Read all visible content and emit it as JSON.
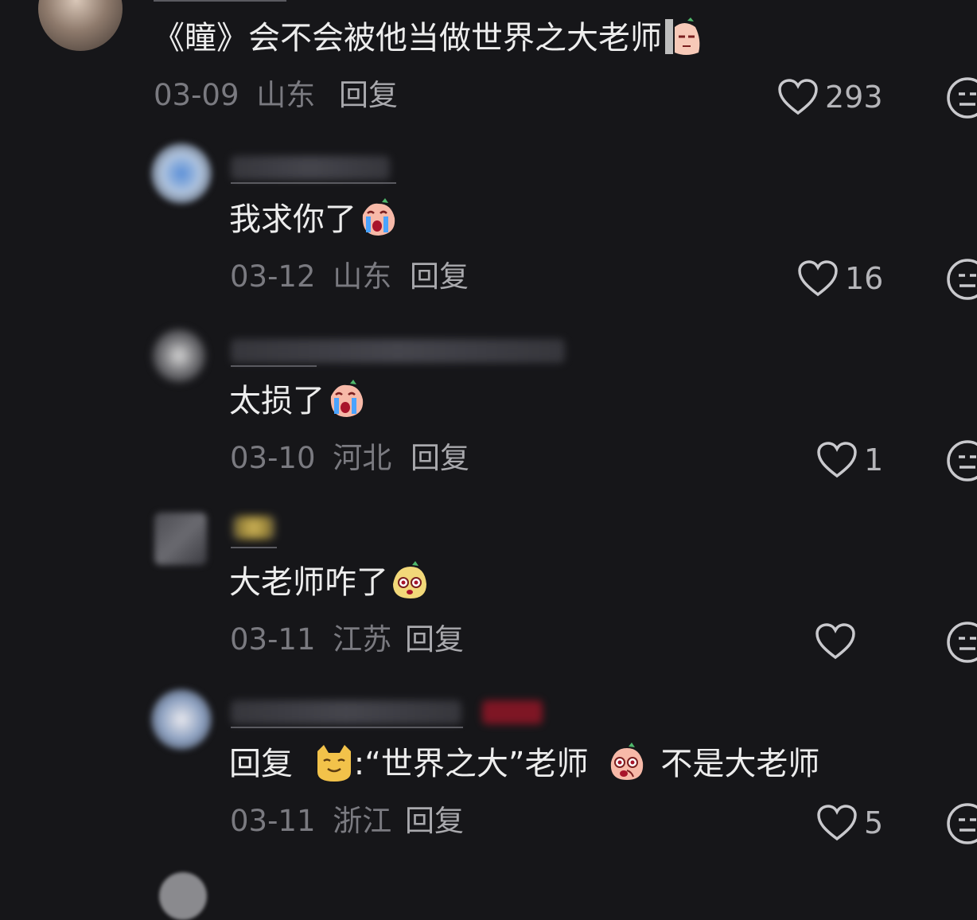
{
  "comments": [
    {
      "text": "《瞳》会不会被他当做世界之大老师",
      "date": "03-09",
      "location": "山东",
      "reply_label": "回复",
      "likes": "293",
      "emoji": "eye-roll-peach-emoji"
    },
    {
      "text": "我求你了",
      "date": "03-12",
      "location": "山东",
      "reply_label": "回复",
      "likes": "16",
      "emoji": "crying-peach-emoji"
    },
    {
      "text": "太损了",
      "date": "03-10",
      "location": "河北",
      "reply_label": "回复",
      "likes": "1",
      "emoji": "crying-peach-emoji"
    },
    {
      "text": "大老师咋了",
      "date": "03-11",
      "location": "江苏",
      "reply_label": "回复",
      "likes": "",
      "emoji": "surprised-peach-emoji"
    },
    {
      "reply_prefix": "回复",
      "text_part1": ":“世界之大”老师",
      "text_part2": "不是大老师",
      "date": "03-11",
      "location": "浙江",
      "reply_label": "回复",
      "likes": "5",
      "emoji": "shocked-peach-emoji"
    }
  ],
  "colors": {
    "background": "#161619",
    "text": "#ededed",
    "meta": "#7a7a80"
  }
}
